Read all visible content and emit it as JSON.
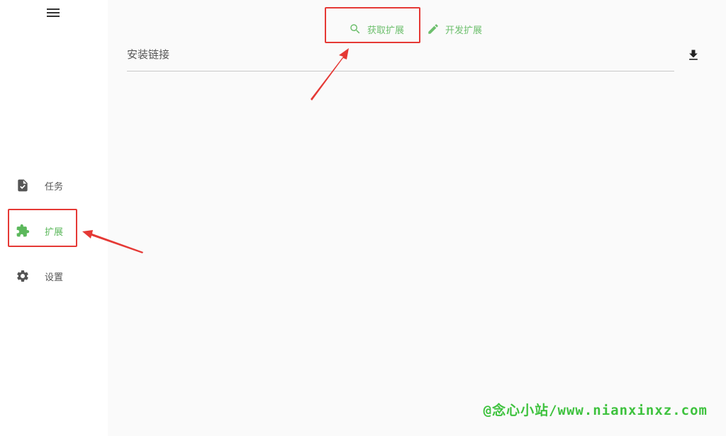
{
  "sidebar": {
    "items": [
      {
        "label": "任务",
        "icon": "file-check-icon"
      },
      {
        "label": "扩展",
        "icon": "puzzle-icon",
        "active": true
      },
      {
        "label": "设置",
        "icon": "gear-icon"
      }
    ]
  },
  "tabs": [
    {
      "label": "获取扩展",
      "icon": "search-icon"
    },
    {
      "label": "开发扩展",
      "icon": "pencil-icon"
    }
  ],
  "install": {
    "label": "安装链接"
  },
  "watermark": "@念心小站/www.nianxinxz.com",
  "colors": {
    "accent": "#5cb85c",
    "highlight": "#e53935",
    "watermark": "#3ec23e"
  }
}
